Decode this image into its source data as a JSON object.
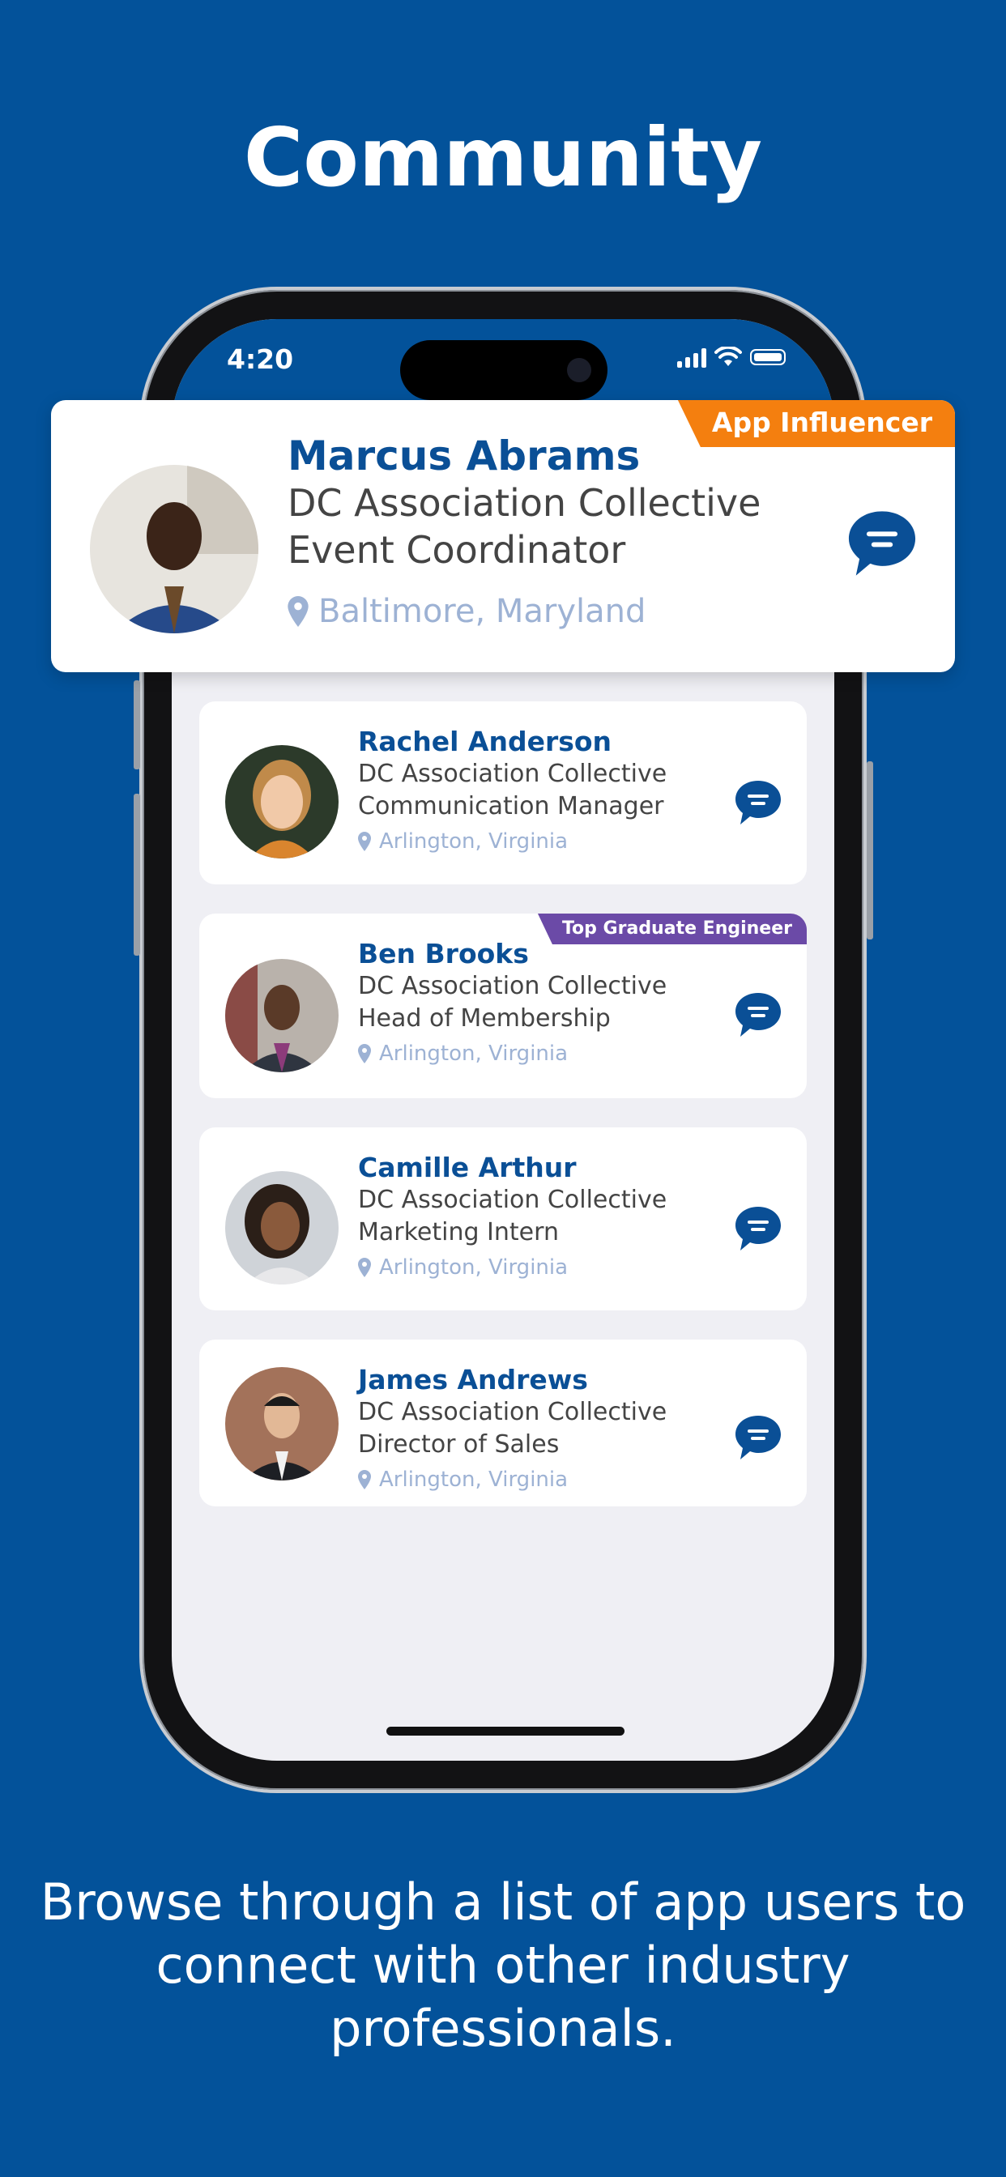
{
  "page": {
    "title": "Community",
    "caption": "Browse through a list of app users to connect with other industry professionals."
  },
  "status_bar": {
    "time": "4:20"
  },
  "featured": {
    "badge": "App Influencer",
    "name": "Marcus Abrams",
    "organization": "DC Association Collective",
    "role": "Event Coordinator",
    "location": "Baltimore, Maryland"
  },
  "members": [
    {
      "name": "Rachel Anderson",
      "organization": "DC Association Collective",
      "role": "Communication Manager",
      "location": "Arlington, Virginia",
      "badge": ""
    },
    {
      "name": "Ben Brooks",
      "organization": "DC Association Collective",
      "role": "Head of Membership",
      "location": "Arlington, Virginia",
      "badge": "Top Graduate Engineer"
    },
    {
      "name": "Camille Arthur",
      "organization": "DC Association Collective",
      "role": "Marketing Intern",
      "location": "Arlington, Virginia",
      "badge": ""
    },
    {
      "name": "James Andrews",
      "organization": "DC Association Collective",
      "role": "Director of Sales",
      "location": "Arlington, Virginia",
      "badge": ""
    }
  ],
  "colors": {
    "background": "#03529a",
    "name_blue": "#0a4f96",
    "influencer_badge": "#f47f0f",
    "graduate_badge": "#6b4aa7",
    "location_text": "#9db2d4"
  }
}
